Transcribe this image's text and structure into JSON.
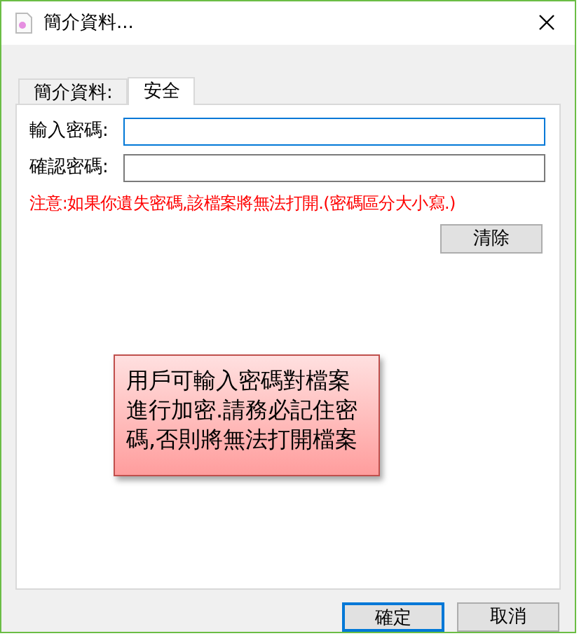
{
  "window": {
    "title": "簡介資料..."
  },
  "tabs": [
    {
      "label": "簡介資料:",
      "selected": false
    },
    {
      "label": "安全",
      "selected": true
    }
  ],
  "fields": [
    {
      "label": "輸入密碼:",
      "focused": true
    },
    {
      "label": "確認密碼:",
      "focused": false
    }
  ],
  "warning": "注意:如果你遺失密碼,該檔案將無法打開.(密碼區分大小寫.)",
  "clear_button": "清除",
  "callout": "用戶可輸入密碼對檔案進行加密.請務必記住密碼,否則將無法打開檔案",
  "buttons": [
    {
      "label": "確定",
      "default": true
    },
    {
      "label": "取消",
      "default": false
    }
  ]
}
